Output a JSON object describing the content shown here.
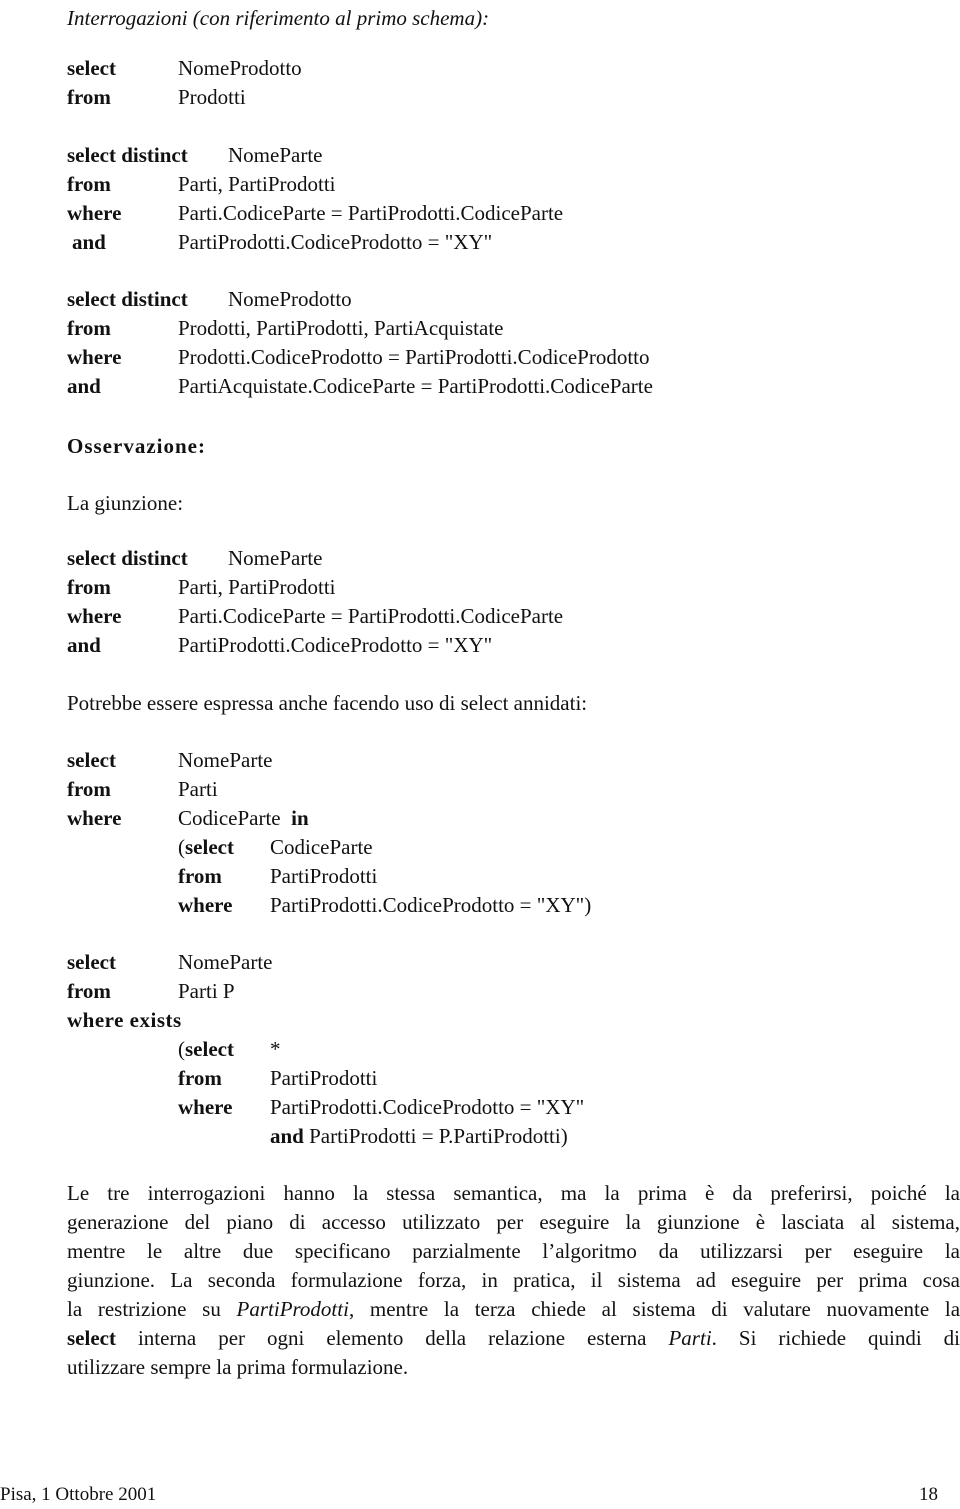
{
  "header": {
    "title": "Interrogazioni (con riferimento al primo schema):"
  },
  "query1": {
    "lines": [
      {
        "kw": "select",
        "val": "NomeProdotto"
      },
      {
        "kw": "from",
        "val": "Prodotti"
      }
    ]
  },
  "query2": {
    "lines": [
      {
        "kw": "select distinct",
        "val": "NomeParte"
      },
      {
        "kw": "from",
        "val": "Parti, PartiProdotti"
      },
      {
        "kw": "where",
        "val": "Parti.CodiceParte = PartiProdotti.CodiceParte"
      },
      {
        "kw": "and",
        "val": "PartiProdotti.CodiceProdotto = \"XY\""
      }
    ]
  },
  "query3": {
    "lines": [
      {
        "kw": "select distinct",
        "val": "NomeProdotto"
      },
      {
        "kw": "from",
        "val": "Prodotti, PartiProdotti, PartiAcquistate"
      },
      {
        "kw": "where",
        "val": "Prodotti.CodiceProdotto = PartiProdotti.CodiceProdotto"
      },
      {
        "kw": "and",
        "val": "PartiAcquistate.CodiceParte = PartiProdotti.CodiceParte"
      }
    ]
  },
  "observation": {
    "heading": "Osservazione:",
    "intro": "La giunzione:"
  },
  "query4": {
    "lines": [
      {
        "kw": "select distinct",
        "val": "NomeParte"
      },
      {
        "kw": "from",
        "val": "Parti, PartiProdotti"
      },
      {
        "kw": "where",
        "val": "Parti.CodiceParte = PartiProdotti.CodiceParte"
      },
      {
        "kw": "and",
        "val": "PartiProdotti.CodiceProdotto = \"XY\""
      }
    ]
  },
  "nested_intro": "Potrebbe essere espressa anche facendo uso di select annidati:",
  "query5": {
    "lines": [
      {
        "kw": "select",
        "val": "NomeParte"
      },
      {
        "kw": "from",
        "val": "Parti"
      },
      {
        "kw": "where",
        "val": "CodiceParte",
        "trail_kw": "in"
      }
    ],
    "nested": [
      {
        "open": "(",
        "kw": "select",
        "val": "CodiceParte"
      },
      {
        "open": "",
        "kw": "from",
        "val": "PartiProdotti"
      },
      {
        "open": "",
        "kw": "where",
        "val": "PartiProdotti.CodiceProdotto = \"XY\")"
      }
    ]
  },
  "query6": {
    "lines": [
      {
        "kw": "select",
        "val": "NomeParte"
      },
      {
        "kw": "from",
        "val": "Parti P"
      },
      {
        "kw": "where exists",
        "val": ""
      }
    ],
    "nested": [
      {
        "open": "(",
        "kw": "select",
        "val": "*"
      },
      {
        "open": "",
        "kw": "from",
        "val": "PartiProdotti"
      },
      {
        "open": "",
        "kw": "where",
        "val": "PartiProdotti.CodiceProdotto = \"XY\""
      }
    ],
    "last": {
      "kw": "and",
      "val": "PartiProdotti = P.PartiProdotti)"
    }
  },
  "conclusion": {
    "lines": [
      [
        {
          "t": "Le tre interrogazioni hanno la stessa semantica, ma la prima è da preferirsi, poiché la"
        }
      ],
      [
        {
          "t": "generazione del piano di accesso utilizzato per eseguire la giunzione è lasciata al sistema,"
        }
      ],
      [
        {
          "t": "mentre le altre due specificano parzialmente l’algoritmo da utilizzarsi per eseguire la"
        }
      ],
      [
        {
          "t": "giunzione. La seconda formulazione forza, in pratica, il sistema ad eseguire per prima cosa"
        }
      ],
      [
        {
          "t": "la restrizione su "
        },
        {
          "t": "PartiProdotti",
          "style": "italic"
        },
        {
          "t": ", mentre la terza chiede al sistema di valutare nuovamente la"
        }
      ],
      [
        {
          "t": "select",
          "style": "bold"
        },
        {
          "t": " interna per ogni elemento della relazione esterna "
        },
        {
          "t": "Parti",
          "style": "italic"
        },
        {
          "t": ". Si richiede quindi di"
        }
      ],
      [
        {
          "t": "utilizzare sempre la prima formulazione."
        }
      ]
    ]
  },
  "footer": {
    "place_date": "Pisa, 1 Ottobre 2001",
    "page_number": "18"
  }
}
